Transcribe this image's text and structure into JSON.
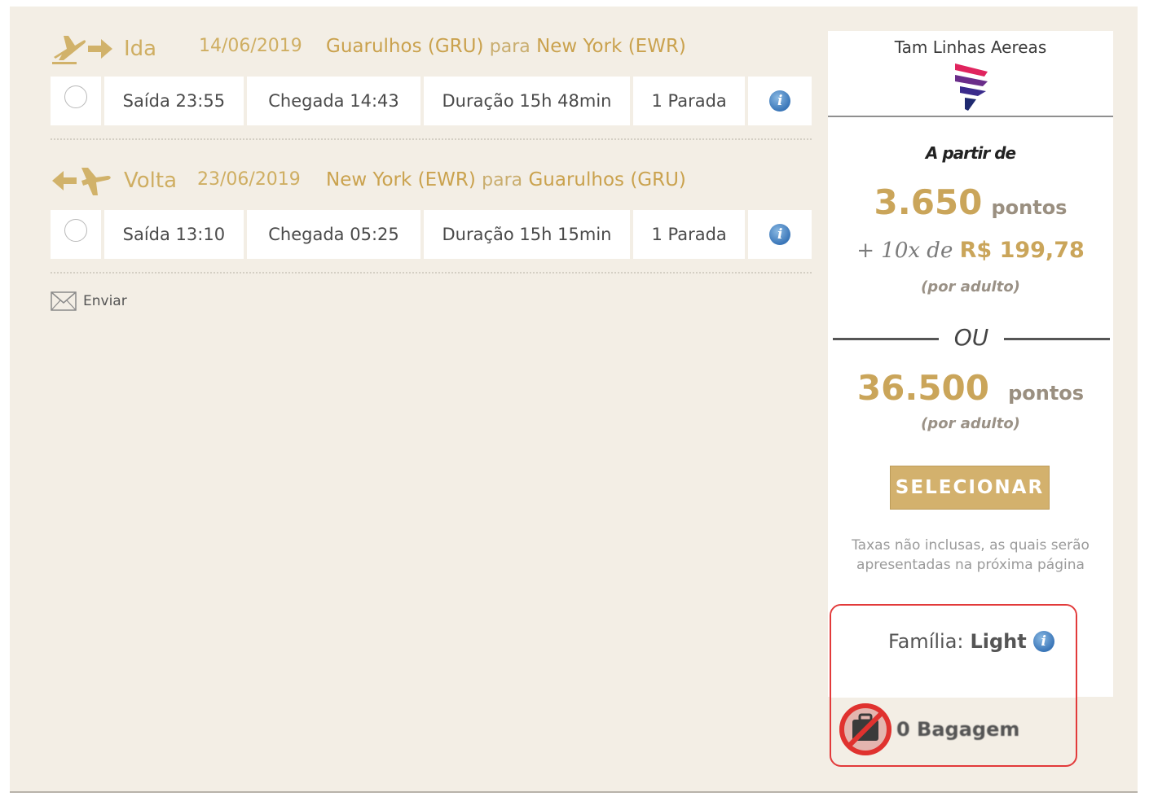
{
  "outbound": {
    "type": "Ida",
    "date": "14/06/2019",
    "origin": "Guarulhos (GRU)",
    "connector": "para",
    "destination": "New York (EWR)",
    "departure": "Saída 23:55",
    "arrival": "Chegada 14:43",
    "duration": "Duração 15h 48min",
    "stops": "1 Parada"
  },
  "inbound": {
    "type": "Volta",
    "date": "23/06/2019",
    "origin": "New York (EWR)",
    "connector": "para",
    "destination": "Guarulhos (GRU)",
    "departure": "Saída 13:10",
    "arrival": "Chegada 05:25",
    "duration": "Duração 15h 15min",
    "stops": "1 Parada"
  },
  "send_label": "Enviar",
  "panel": {
    "airline": "Tam Linhas Aereas",
    "from_label": "A partir de",
    "option1_points": "3.650",
    "points_unit": "pontos",
    "plus_prefix": "+ 10x de",
    "installment": "R$ 199,78",
    "per_adult": "(por adulto)",
    "or_label": "OU",
    "option2_points": "36.500",
    "select_label": "SELECIONAR",
    "taxes_line1": "Taxas não inclusas, as quais serão",
    "taxes_line2": "apresentadas na próxima página",
    "family_label": "Família:",
    "family_value": "Light",
    "baggage_label": "0 Bagagem"
  },
  "info_glyph": "i",
  "colors": {
    "gold": "#caa55a",
    "background": "#f3eee5",
    "highlight": "#e23a3a",
    "info": "#3a76b8"
  }
}
